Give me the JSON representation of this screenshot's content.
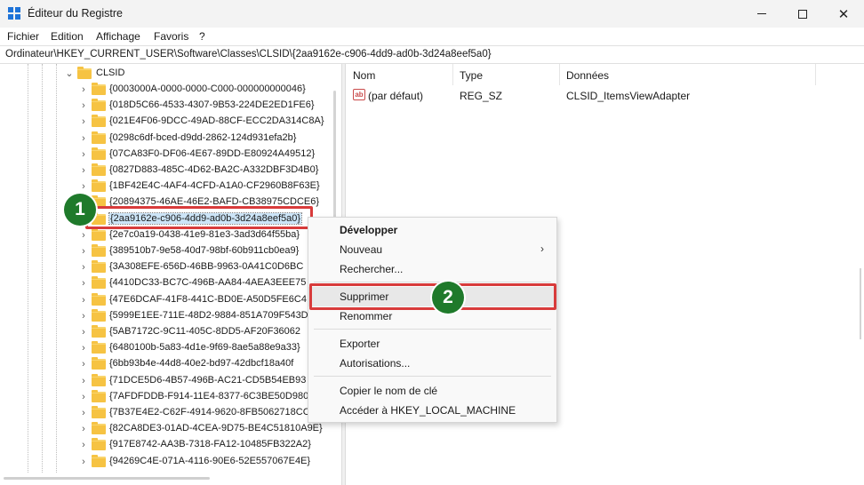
{
  "window": {
    "title": "Éditeur du Registre",
    "min_glyph": "",
    "max_glyph": "",
    "close_glyph": "✕"
  },
  "menu": {
    "items": [
      "Fichier",
      "Edition",
      "Affichage",
      "Favoris",
      "?"
    ]
  },
  "address": {
    "path": "Ordinateur\\HKEY_CURRENT_USER\\Software\\Classes\\CLSID\\{2aa9162e-c906-4dd9-ad0b-3d24a8eef5a0}"
  },
  "tree": {
    "parent_label": "CLSID",
    "items": [
      "{0003000A-0000-0000-C000-000000000046}",
      "{018D5C66-4533-4307-9B53-224DE2ED1FE6}",
      "{021E4F06-9DCC-49AD-88CF-ECC2DA314C8A}",
      "{0298c6df-bced-d9dd-2862-124d931efa2b}",
      "{07CA83F0-DF06-4E67-89DD-E80924A49512}",
      "{0827D883-485C-4D62-BA2C-A332DBF3D4B0}",
      "{1BF42E4C-4AF4-4CFD-A1A0-CF2960B8F63E}",
      "{20894375-46AE-46E2-BAFD-CB38975CDCE6}",
      "{2aa9162e-c906-4dd9-ad0b-3d24a8eef5a0}",
      "{2e7c0a19-0438-41e9-81e3-3ad3d64f55ba}",
      "{389510b7-9e58-40d7-98bf-60b911cb0ea9}",
      "{3A308EFE-656D-46BB-9963-0A41C0D6BC",
      "{4410DC33-BC7C-496B-AA84-4AEA3EEE75",
      "{47E6DCAF-41F8-441C-BD0E-A50D5FE6C4",
      "{5999E1EE-711E-48D2-9884-851A709F543D",
      "{5AB7172C-9C11-405C-8DD5-AF20F36062",
      "{6480100b-5a83-4d1e-9f69-8ae5a88e9a33}",
      "{6bb93b4e-44d8-40e2-bd97-42dbcf18a40f",
      "{71DCE5D6-4B57-496B-AC21-CD5B54EB93",
      "{7AFDFDDB-F914-11E4-8377-6C3BE50D980",
      "{7B37E4E2-C62F-4914-9620-8FB5062718CC",
      "{82CA8DE3-01AD-4CEA-9D75-BE4C51810A9E}",
      "{917E8742-AA3B-7318-FA12-10485FB322A2}",
      "{94269C4E-071A-4116-90E6-52E557067E4E}"
    ],
    "selected_index": 8
  },
  "list": {
    "headers": {
      "name": "Nom",
      "type": "Type",
      "data": "Données"
    },
    "rows": [
      {
        "name": "(par défaut)",
        "type": "REG_SZ",
        "data": "CLSID_ItemsViewAdapter",
        "icon": "ab"
      }
    ]
  },
  "context_menu": {
    "items": [
      {
        "label": "Développer",
        "bold": true
      },
      {
        "label": "Nouveau",
        "submenu": true,
        "arrow": "›"
      },
      {
        "label": "Rechercher..."
      },
      {
        "label": "Supprimer",
        "highlighted": true
      },
      {
        "label": "Renommer"
      },
      {
        "label": "Exporter"
      },
      {
        "label": "Autorisations..."
      },
      {
        "label": "Copier le nom de clé"
      },
      {
        "label": "Accéder à HKEY_LOCAL_MACHINE"
      }
    ]
  },
  "badges": {
    "step1": "1",
    "step2": "2"
  },
  "colors": {
    "highlight_red": "#d83b3b",
    "badge_green": "#1f7a2b",
    "folder_yellow": "#f6c343",
    "selection_blue": "#cce4f7",
    "app_icon_blue": "#1e73d8"
  }
}
